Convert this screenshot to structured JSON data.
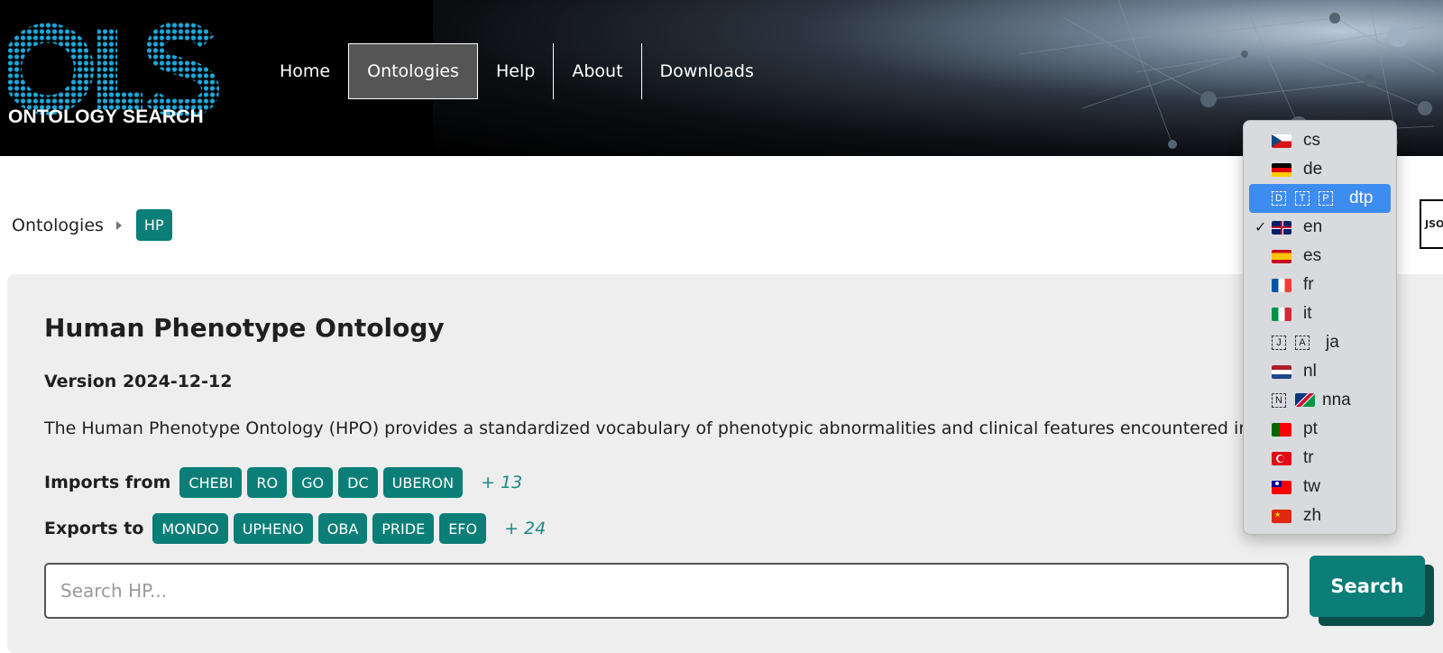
{
  "header": {
    "logo_text": "OLS",
    "logo_subtitle": "ONTOLOGY SEARCH",
    "nav": [
      {
        "label": "Home",
        "active": false
      },
      {
        "label": "Ontologies",
        "active": true
      },
      {
        "label": "Help",
        "active": false
      },
      {
        "label": "About",
        "active": false
      },
      {
        "label": "Downloads",
        "active": false
      }
    ]
  },
  "breadcrumb": {
    "link": "Ontologies",
    "current": "HP"
  },
  "json_button": "JSO",
  "ontology": {
    "title": "Human Phenotype Ontology",
    "version": "Version 2024-12-12",
    "description": "The Human Phenotype Ontology (HPO) provides a standardized vocabulary of phenotypic abnormalities and clinical features encountered in hu",
    "imports_label": "Imports from",
    "imports": [
      "CHEBI",
      "RO",
      "GO",
      "DC",
      "UBERON"
    ],
    "imports_more": "+ 13",
    "exports_label": "Exports to",
    "exports": [
      "MONDO",
      "UPHENO",
      "OBA",
      "PRIDE",
      "EFO"
    ],
    "exports_more": "+ 24"
  },
  "search": {
    "placeholder": "Search HP...",
    "button_label": "Search"
  },
  "language_menu": {
    "selected": "en",
    "highlighted": "dtp",
    "items": [
      {
        "code": "cs",
        "flag": "czech-flag"
      },
      {
        "code": "de",
        "flag": "german-flag"
      },
      {
        "code": "dtp",
        "letters": [
          "D",
          "T",
          "P"
        ]
      },
      {
        "code": "en",
        "flag": "uk-flag",
        "checked": true
      },
      {
        "code": "es",
        "flag": "spanish-flag"
      },
      {
        "code": "fr",
        "flag": "french-flag"
      },
      {
        "code": "it",
        "flag": "italian-flag"
      },
      {
        "code": "ja",
        "letters": [
          "J",
          "A"
        ]
      },
      {
        "code": "nl",
        "flag": "dutch-flag"
      },
      {
        "code": "nna",
        "letters": [
          "N"
        ],
        "flag": "namibian-flag"
      },
      {
        "code": "pt",
        "flag": "portuguese-flag"
      },
      {
        "code": "tr",
        "flag": "turkish-flag"
      },
      {
        "code": "tw",
        "flag": "taiwan-flag"
      },
      {
        "code": "zh",
        "flag": "chinese-flag"
      }
    ]
  },
  "colors": {
    "accent": "#0b7e77",
    "header_bg": "#000000",
    "menu_highlight": "#3d8cf0"
  }
}
